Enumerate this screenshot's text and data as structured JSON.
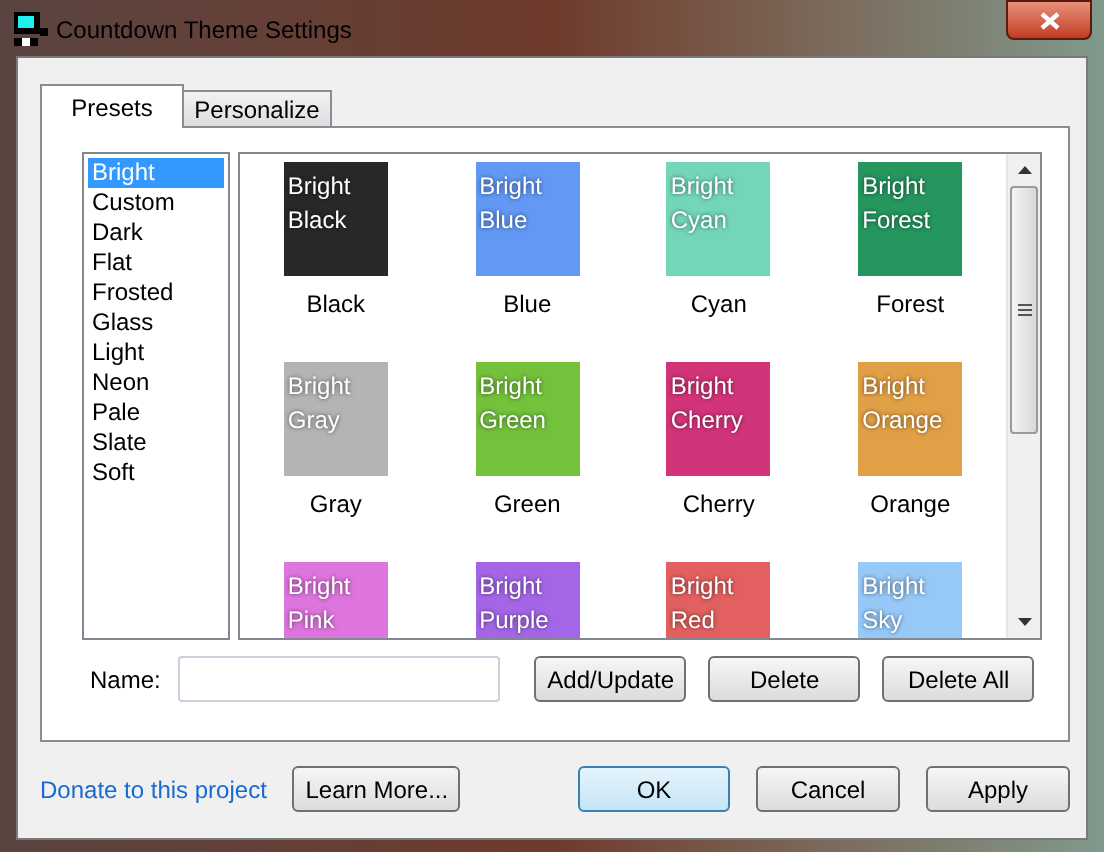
{
  "window": {
    "title": "Countdown Theme Settings"
  },
  "tabs": [
    {
      "label": "Presets",
      "selected": true
    },
    {
      "label": "Personalize",
      "selected": false
    }
  ],
  "categories": [
    {
      "label": "Bright",
      "selected": true
    },
    {
      "label": "Custom",
      "selected": false
    },
    {
      "label": "Dark",
      "selected": false
    },
    {
      "label": "Flat",
      "selected": false
    },
    {
      "label": "Frosted",
      "selected": false
    },
    {
      "label": "Glass",
      "selected": false
    },
    {
      "label": "Light",
      "selected": false
    },
    {
      "label": "Neon",
      "selected": false
    },
    {
      "label": "Pale",
      "selected": false
    },
    {
      "label": "Slate",
      "selected": false
    },
    {
      "label": "Soft",
      "selected": false
    }
  ],
  "themes": [
    {
      "lines": [
        "Bright",
        "Black"
      ],
      "label": "Black",
      "color": "#282828"
    },
    {
      "lines": [
        "Bright",
        "Blue"
      ],
      "label": "Blue",
      "color": "#6199f5"
    },
    {
      "lines": [
        "Bright",
        "Cyan"
      ],
      "label": "Cyan",
      "color": "#74d6b9"
    },
    {
      "lines": [
        "Bright",
        "Forest"
      ],
      "label": "Forest",
      "color": "#26965f"
    },
    {
      "lines": [
        "Bright",
        "Gray"
      ],
      "label": "Gray",
      "color": "#b4b4b4"
    },
    {
      "lines": [
        "Bright",
        "Green"
      ],
      "label": "Green",
      "color": "#74c13c"
    },
    {
      "lines": [
        "Bright",
        "Cherry"
      ],
      "label": "Cherry",
      "color": "#d2347a"
    },
    {
      "lines": [
        "Bright",
        "Orange"
      ],
      "label": "Orange",
      "color": "#e2a046"
    },
    {
      "lines": [
        "Bright",
        "Pink"
      ],
      "color": "#de74de"
    },
    {
      "lines": [
        "Bright",
        "Purple"
      ],
      "color": "#a466e6"
    },
    {
      "lines": [
        "Bright",
        "Red"
      ],
      "color": "#e26060"
    },
    {
      "lines": [
        "Bright",
        "Sky"
      ],
      "color": "#96c8f8"
    }
  ],
  "name_field": {
    "label": "Name:"
  },
  "list_buttons": [
    "Add/Update",
    "Delete",
    "Delete All"
  ],
  "donate_link": "Donate to this project",
  "learn_more_button": "Learn More...",
  "dialog_buttons": [
    {
      "label": "OK",
      "default": true
    },
    {
      "label": "Cancel",
      "default": false
    },
    {
      "label": "Apply",
      "default": false
    }
  ]
}
